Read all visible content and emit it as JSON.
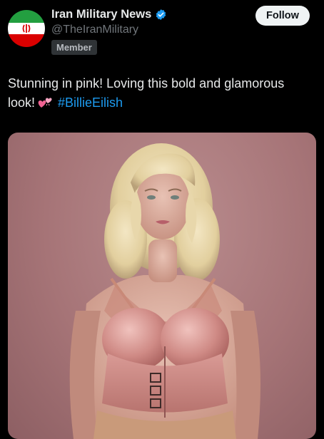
{
  "author": {
    "display_name": "Iran Military News",
    "handle": "@TheIranMilitary",
    "badge": "Member",
    "verified": true
  },
  "follow_button": {
    "label": "Follow"
  },
  "post": {
    "text_line1": "Stunning in pink! Loving this bold and glamorous",
    "text_line2": "look!",
    "emoji": "two-hearts-icon",
    "hashtag": "#BillieEilish"
  },
  "colors": {
    "background": "#000000",
    "text": "#e7e9ea",
    "muted": "#71767b",
    "link": "#1d9bf0",
    "verified": "#1d9bf0",
    "flag_green": "#239f40",
    "flag_white": "#ffffff",
    "flag_red": "#da0000",
    "photo_backdrop": "#a67477"
  }
}
